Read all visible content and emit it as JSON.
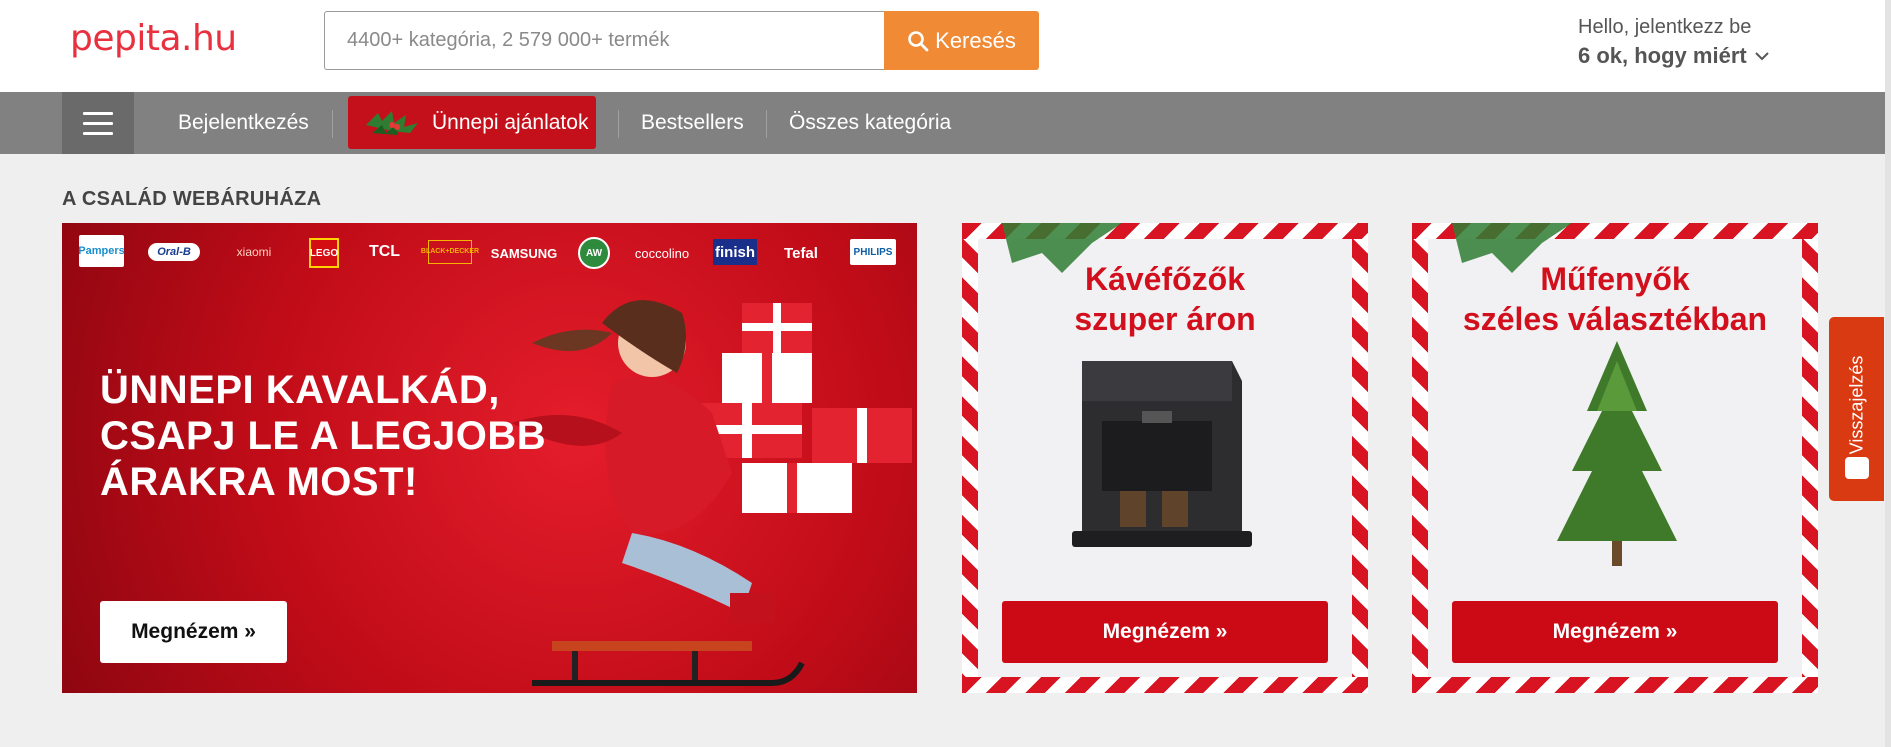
{
  "header": {
    "logo": "pepita.hu",
    "search_placeholder": "4400+ kategória, 2 579 000+ termék",
    "search_button": "Keresés",
    "hello": "Hello, jelentkezz be",
    "why": "6 ok, hogy miért"
  },
  "nav": {
    "login": "Bejelentkezés",
    "holiday": "Ünnepi ajánlatok",
    "bestsellers": "Bestsellers",
    "all_categories": "Összes kategória"
  },
  "section_title": "A CSALÁD WEBÁRUHÁZA",
  "banner": {
    "brands": [
      "Pampers",
      "Oral-B",
      "xiaomi",
      "LEGO",
      "TCL",
      "BLACK+DECKER",
      "SAMSUNG",
      "AW",
      "coccolino",
      "finish",
      "Tefal",
      "PHILIPS"
    ],
    "headline_1": "ÜNNEPI KAVALKÁD,",
    "headline_2": "CSAPJ LE A LEGJOBB",
    "headline_3": "ÁRAKRA MOST!",
    "button": "Megnézem »"
  },
  "cards": [
    {
      "title_1": "Kávéfőzők",
      "title_2": "szuper áron",
      "button": "Megnézem »"
    },
    {
      "title_1": "Műfenyők",
      "title_2": "széles választékban",
      "button": "Megnézem »"
    }
  ],
  "feedback": "Visszajelzés",
  "colors": {
    "brand_red": "#e8303e",
    "accent_orange": "#f08a35",
    "nav_gray": "#818181",
    "promo_red": "#cc0a16"
  }
}
